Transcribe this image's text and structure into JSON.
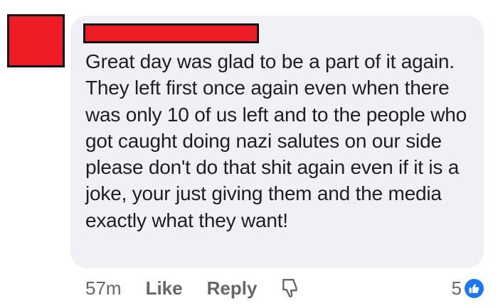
{
  "comment": {
    "text": "Great day was glad to be a part of it again. They left first once again even when there was only 10 of us left and to the people who got caught doing nazi salutes on our side please don't do that shit again even if it is a joke, your just giving them and the media exactly what they want!"
  },
  "actions": {
    "time": "57m",
    "like_label": "Like",
    "reply_label": "Reply"
  },
  "reactions": {
    "count": "5",
    "icon": "thumbs-up-icon"
  },
  "colors": {
    "redaction": "#ee1d25",
    "bubble": "#eff1f5",
    "text": "#1c1e21",
    "muted": "#65676b",
    "like_badge": "#1877f2"
  }
}
